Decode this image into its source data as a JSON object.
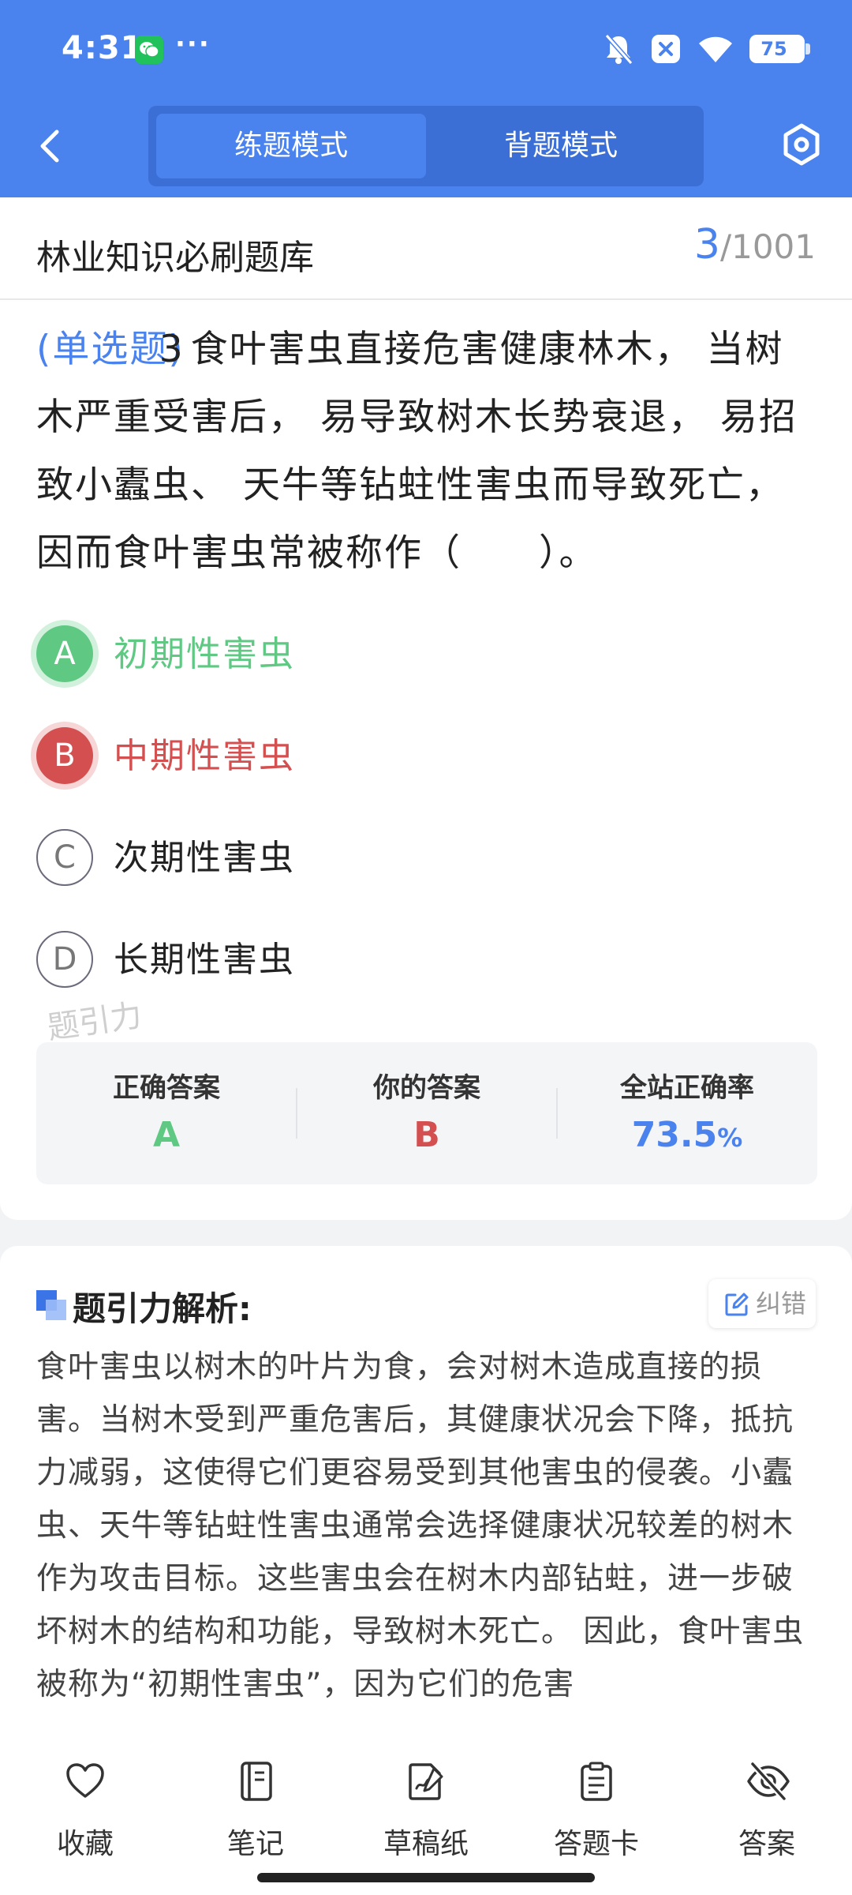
{
  "status_bar": {
    "time": "4:31",
    "more": "···",
    "battery": "75",
    "icons": [
      "wechat-icon",
      "bell-off-icon",
      "x-box-icon",
      "wifi-icon",
      "battery-icon"
    ]
  },
  "header": {
    "modes": [
      {
        "label": "练题模式",
        "active": true
      },
      {
        "label": "背题模式",
        "active": false
      }
    ]
  },
  "question": {
    "bank_title": "林业知识必刷题库",
    "current": "3",
    "total": "/1001",
    "type": "(单选题)",
    "number": "3",
    "stem": "食叶害虫直接危害健康林木， 当树木严重受害后， 易导致树木长势衰退， 易招致小蠹虫、 天牛等钻蛀性害虫而导致死亡， 因而食叶害虫常被称作（　　）。",
    "options": [
      {
        "letter": "A",
        "text": "初期性害虫",
        "state": "correct"
      },
      {
        "letter": "B",
        "text": "中期性害虫",
        "state": "wrong"
      },
      {
        "letter": "C",
        "text": "次期性害虫",
        "state": "normal"
      },
      {
        "letter": "D",
        "text": "长期性害虫",
        "state": "normal"
      }
    ],
    "watermark": "题引力"
  },
  "answer_summary": {
    "correct_label": "正确答案",
    "correct_value": "A",
    "yours_label": "你的答案",
    "yours_value": "B",
    "rate_label": "全站正确率",
    "rate_value": "73.5",
    "rate_unit": "%"
  },
  "analysis": {
    "title": "题引力解析:",
    "report_label": "纠错",
    "text": "食叶害虫以树木的叶片为食，会对树木造成直接的损害。当树木受到严重危害后，其健康状况会下降，抵抗力减弱，这使得它们更容易受到其他害虫的侵袭。小蠹虫、天牛等钻蛀性害虫通常会选择健康状况较差的树木作为攻击目标。这些害虫会在树木内部钻蛀，进一步破坏树木的结构和功能，导致树木死亡。 因此，食叶害虫被称为“初期性害虫”，因为它们的危害"
  },
  "bottom_nav": [
    {
      "label": "收藏",
      "icon": "heart-icon"
    },
    {
      "label": "笔记",
      "icon": "notebook-icon"
    },
    {
      "label": "草稿纸",
      "icon": "draft-paper-icon"
    },
    {
      "label": "答题卡",
      "icon": "answer-card-icon"
    },
    {
      "label": "答案",
      "icon": "eye-off-icon"
    }
  ],
  "colors": {
    "primary": "#4a82ee",
    "correct": "#5fc984",
    "wrong": "#d44f4f"
  }
}
